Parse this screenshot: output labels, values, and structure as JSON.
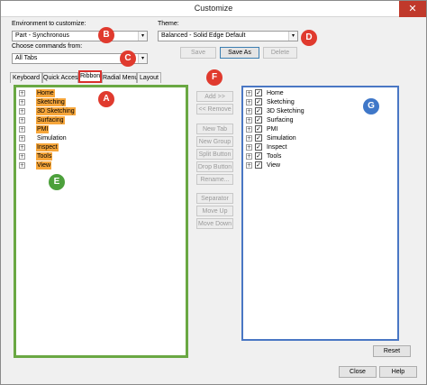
{
  "window": {
    "title": "Customize",
    "close_glyph": "✕"
  },
  "environment": {
    "label": "Environment to customize:",
    "value": "Part - Synchronous"
  },
  "theme": {
    "label": "Theme:",
    "value": "Balanced - Solid Edge Default"
  },
  "commands_from": {
    "label": "Choose commands from:",
    "value": "All Tabs"
  },
  "theme_buttons": {
    "save": "Save",
    "save_as": "Save As",
    "delete": "Delete"
  },
  "tabs": [
    {
      "label": "Keyboard"
    },
    {
      "label": "Quick Access"
    },
    {
      "label": "Ribbon"
    },
    {
      "label": "Radial Menu"
    },
    {
      "label": "Layout"
    }
  ],
  "left_tree": [
    {
      "label": "Home"
    },
    {
      "label": "Sketching"
    },
    {
      "label": "3D Sketching"
    },
    {
      "label": "Surfacing"
    },
    {
      "label": "PMI"
    },
    {
      "label": "Simulation"
    },
    {
      "label": "Inspect"
    },
    {
      "label": "Tools"
    },
    {
      "label": "View"
    }
  ],
  "right_tree": [
    {
      "label": "Home"
    },
    {
      "label": "Sketching"
    },
    {
      "label": "3D Sketching"
    },
    {
      "label": "Surfacing"
    },
    {
      "label": "PMI"
    },
    {
      "label": "Simulation"
    },
    {
      "label": "Inspect"
    },
    {
      "label": "Tools"
    },
    {
      "label": "View"
    }
  ],
  "middle_buttons": {
    "add": "Add >>",
    "remove": "<< Remove",
    "new_tab": "New Tab",
    "new_group": "New Group",
    "split_button": "Split Button",
    "drop_button": "Drop Button",
    "rename": "Rename...",
    "separator": "Separator",
    "move_up": "Move Up",
    "move_down": "Move Down"
  },
  "bottom_buttons": {
    "reset": "Reset",
    "close": "Close",
    "help": "Help"
  },
  "markers": {
    "a": "A",
    "b": "B",
    "c": "C",
    "d": "D",
    "e": "E",
    "f": "F",
    "g": "G"
  },
  "glyphs": {
    "expander": "+",
    "check": "✓",
    "dropdown": "▾"
  },
  "colors": {
    "highlight": "#f7a63a",
    "marker_red": "#e03a2e",
    "marker_green": "#4ca03b",
    "marker_blue": "#3f77c8"
  }
}
